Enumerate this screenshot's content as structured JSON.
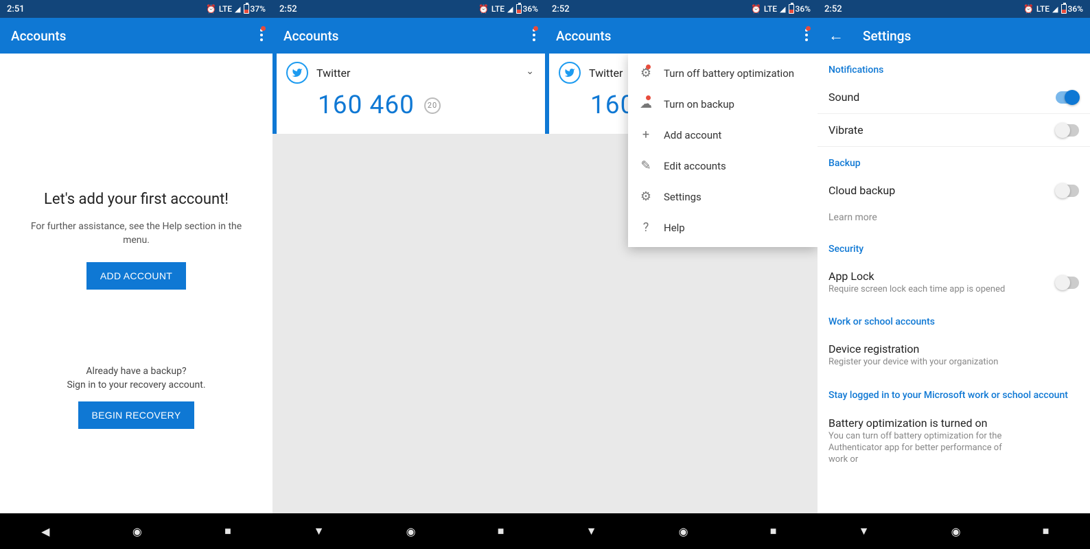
{
  "screens": [
    {
      "status": {
        "time": "2:51",
        "lte": "LTE",
        "battery": "37%"
      },
      "appbar": {
        "title": "Accounts"
      },
      "welcome": {
        "heading": "Let's add your first account!",
        "sub": "For further assistance, see the Help section in the menu.",
        "addBtn": "ADD ACCOUNT",
        "recoveryQ": "Already have a backup?\nSign in to your recovery account.",
        "recoveryBtn": "BEGIN RECOVERY"
      }
    },
    {
      "status": {
        "time": "2:52",
        "lte": "LTE",
        "battery": "36%"
      },
      "appbar": {
        "title": "Accounts"
      },
      "account": {
        "name": "Twitter",
        "code": "160 460",
        "timer": "20"
      }
    },
    {
      "status": {
        "time": "2:52",
        "lte": "LTE",
        "battery": "36%"
      },
      "appbar": {
        "title": "Accounts"
      },
      "account": {
        "name": "Twitter",
        "code": "160",
        "timer": ""
      },
      "menu": [
        {
          "icon": "gear",
          "label": "Turn off battery optimization",
          "dot": true
        },
        {
          "icon": "cloud",
          "label": "Turn on backup",
          "dot": true
        },
        {
          "icon": "plus",
          "label": "Add account"
        },
        {
          "icon": "pencil",
          "label": "Edit accounts"
        },
        {
          "icon": "gear2",
          "label": "Settings"
        },
        {
          "icon": "help",
          "label": "Help"
        }
      ]
    },
    {
      "status": {
        "time": "2:52",
        "lte": "LTE",
        "battery": "36%"
      },
      "appbar": {
        "title": "Settings",
        "back": true
      },
      "settings": {
        "sections": [
          {
            "header": "Notifications",
            "rows": [
              {
                "label": "Sound",
                "toggle": true,
                "on": true
              },
              {
                "label": "Vibrate",
                "toggle": true,
                "on": false
              }
            ]
          },
          {
            "header": "Backup",
            "rows": [
              {
                "label": "Cloud backup",
                "toggle": true,
                "on": false
              }
            ],
            "link": "Learn more"
          },
          {
            "header": "Security",
            "rows": [
              {
                "label": "App Lock",
                "sub": "Require screen lock each time app is opened",
                "toggle": true,
                "on": false
              }
            ]
          },
          {
            "header": "Work or school accounts",
            "rows": [
              {
                "label": "Device registration",
                "sub": "Register your device with your organization"
              }
            ]
          },
          {
            "header": "Stay logged in to your Microsoft work or school account",
            "rows": [
              {
                "label": "Battery optimization is turned on",
                "sub": "You can turn off battery optimization for the Authenticator app for better performance of work or"
              }
            ]
          }
        ]
      }
    }
  ]
}
